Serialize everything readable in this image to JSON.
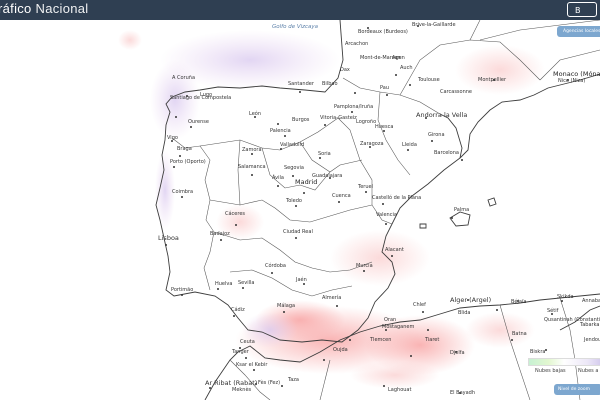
{
  "app": {
    "brand_prefix": "ráfico",
    "brand_suffix": "Nacional",
    "top_button": "B"
  },
  "controls": {
    "agencies_button": "Agencias locales",
    "zoom_button": "Nivel de zoom"
  },
  "legend": {
    "low_clouds": "Nubes bajas",
    "high_clouds": "Nubes a"
  },
  "map_labels": [
    {
      "id": "golfo",
      "text": "Golfo de Vizcaya",
      "kind": "sea"
    },
    {
      "id": "bordeaux",
      "text": "Bordeaux (Burdeos)",
      "kind": "city"
    },
    {
      "id": "brive",
      "text": "Brive-la-Gaillarde",
      "kind": "city"
    },
    {
      "id": "arcachon",
      "text": "Arcachon",
      "kind": "city"
    },
    {
      "id": "agen",
      "text": "Agen",
      "kind": "city"
    },
    {
      "id": "auch",
      "text": "Auch",
      "kind": "city"
    },
    {
      "id": "toulouse",
      "text": "Toulouse",
      "kind": "city"
    },
    {
      "id": "montpellier",
      "text": "Montpellier",
      "kind": "city"
    },
    {
      "id": "monaco",
      "text": "Monaco (Mónaco)",
      "kind": "cap"
    },
    {
      "id": "nice",
      "text": "Nice (Niza)",
      "kind": "city"
    },
    {
      "id": "mdm",
      "text": "Mont-de-Marsan",
      "kind": "city"
    },
    {
      "id": "dax",
      "text": "Dax",
      "kind": "city"
    },
    {
      "id": "pau",
      "text": "Pau",
      "kind": "city"
    },
    {
      "id": "carcassonne",
      "text": "Carcassonne",
      "kind": "city"
    },
    {
      "id": "andorra",
      "text": "Andorra la Vella",
      "kind": "big"
    },
    {
      "id": "santander",
      "text": "Santander",
      "kind": "city"
    },
    {
      "id": "bilbao",
      "text": "Bilbao",
      "kind": "city"
    },
    {
      "id": "vitoria",
      "text": "Vitoria-Gasteiz",
      "kind": "city"
    },
    {
      "id": "pamplona",
      "text": "Pamplona/Iruña",
      "kind": "city"
    },
    {
      "id": "coruna",
      "text": "A Coruña",
      "kind": "city"
    },
    {
      "id": "santiago",
      "text": "Santiago de Compostela",
      "kind": "city"
    },
    {
      "id": "lugo",
      "text": "Lugo",
      "kind": "city"
    },
    {
      "id": "ourense",
      "text": "Ourense",
      "kind": "city"
    },
    {
      "id": "vigo",
      "text": "Vigo",
      "kind": "city"
    },
    {
      "id": "leon",
      "text": "León",
      "kind": "city"
    },
    {
      "id": "burgos",
      "text": "Burgos",
      "kind": "city"
    },
    {
      "id": "logrono",
      "text": "Logroño",
      "kind": "city"
    },
    {
      "id": "huesca",
      "text": "Huesca",
      "kind": "city"
    },
    {
      "id": "girona",
      "text": "Girona",
      "kind": "city"
    },
    {
      "id": "palencia",
      "text": "Palencia",
      "kind": "city"
    },
    {
      "id": "valladolid",
      "text": "Valladolid",
      "kind": "city"
    },
    {
      "id": "zamora",
      "text": "Zamora",
      "kind": "city"
    },
    {
      "id": "soria",
      "text": "Soria",
      "kind": "city"
    },
    {
      "id": "zaragoza",
      "text": "Zaragoza",
      "kind": "city"
    },
    {
      "id": "lleida",
      "text": "Lleida",
      "kind": "city"
    },
    {
      "id": "barcelona",
      "text": "Barcelona",
      "kind": "city"
    },
    {
      "id": "braga",
      "text": "Braga",
      "kind": "city"
    },
    {
      "id": "porto",
      "text": "Porto (Oporto)",
      "kind": "city"
    },
    {
      "id": "salamanca",
      "text": "Salamanca",
      "kind": "city"
    },
    {
      "id": "segovia",
      "text": "Segovia",
      "kind": "city"
    },
    {
      "id": "guadalajara",
      "text": "Guadalajara",
      "kind": "city"
    },
    {
      "id": "madrid",
      "text": "Madrid",
      "kind": "cap"
    },
    {
      "id": "avila",
      "text": "Ávila",
      "kind": "city"
    },
    {
      "id": "teruel",
      "text": "Teruel",
      "kind": "city"
    },
    {
      "id": "toledo",
      "text": "Toledo",
      "kind": "city"
    },
    {
      "id": "cuenca",
      "text": "Cuenca",
      "kind": "city"
    },
    {
      "id": "castellon",
      "text": "Castelló de la Plana",
      "kind": "city"
    },
    {
      "id": "coimbra",
      "text": "Coimbra",
      "kind": "city"
    },
    {
      "id": "caceres",
      "text": "Cáceres",
      "kind": "city"
    },
    {
      "id": "valencia",
      "text": "Valencia",
      "kind": "city"
    },
    {
      "id": "palma",
      "text": "Palma",
      "kind": "city"
    },
    {
      "id": "badajoz",
      "text": "Badajoz",
      "kind": "city"
    },
    {
      "id": "ciudadreal",
      "text": "Ciudad Real",
      "kind": "city"
    },
    {
      "id": "lisboa",
      "text": "Lisboa",
      "kind": "big"
    },
    {
      "id": "cordoba",
      "text": "Córdoba",
      "kind": "city"
    },
    {
      "id": "jaen",
      "text": "Jaén",
      "kind": "city"
    },
    {
      "id": "murcia",
      "text": "Murcia",
      "kind": "city"
    },
    {
      "id": "alicante",
      "text": "Alacant",
      "kind": "city"
    },
    {
      "id": "portimao",
      "text": "Portimão",
      "kind": "city"
    },
    {
      "id": "huelva",
      "text": "Huelva",
      "kind": "city"
    },
    {
      "id": "sevilla",
      "text": "Sevilla",
      "kind": "city"
    },
    {
      "id": "malaga",
      "text": "Málaga",
      "kind": "city"
    },
    {
      "id": "almeria",
      "text": "Almería",
      "kind": "city"
    },
    {
      "id": "cadiz",
      "text": "Cádiz",
      "kind": "city"
    },
    {
      "id": "ceuta",
      "text": "Ceuta",
      "kind": "city"
    },
    {
      "id": "tanger",
      "text": "Tanger",
      "kind": "city"
    },
    {
      "id": "ksar",
      "text": "Ksar el Kebir",
      "kind": "city"
    },
    {
      "id": "alger",
      "text": "Alger (Argel)",
      "kind": "big"
    },
    {
      "id": "skikda",
      "text": "Skikda",
      "kind": "city"
    },
    {
      "id": "annaba",
      "text": "Annaba",
      "kind": "city"
    },
    {
      "id": "bejaia",
      "text": "Béjaïa",
      "kind": "city"
    },
    {
      "id": "setif",
      "text": "Sétif",
      "kind": "city"
    },
    {
      "id": "constantine",
      "text": "Qusantinah (Constantina)",
      "kind": "city"
    },
    {
      "id": "chlef",
      "text": "Chlef",
      "kind": "city"
    },
    {
      "id": "blida",
      "text": "Blida",
      "kind": "city"
    },
    {
      "id": "batna",
      "text": "Batna",
      "kind": "city"
    },
    {
      "id": "mostaganem",
      "text": "Mostaganem",
      "kind": "city"
    },
    {
      "id": "oran",
      "text": "Oran",
      "kind": "city"
    },
    {
      "id": "tlemcen",
      "text": "Tlemcen",
      "kind": "city"
    },
    {
      "id": "tiaret",
      "text": "Tiaret",
      "kind": "city"
    },
    {
      "id": "djelfa",
      "text": "Djelfa",
      "kind": "city"
    },
    {
      "id": "biskra",
      "text": "Biskra",
      "kind": "city"
    },
    {
      "id": "oujda",
      "text": "Oujda",
      "kind": "city"
    },
    {
      "id": "rabat",
      "text": "Ar Ribat (Rabat)",
      "kind": "big"
    },
    {
      "id": "fes",
      "text": "Fès (Fez)",
      "kind": "city"
    },
    {
      "id": "taza",
      "text": "Taza",
      "kind": "city"
    },
    {
      "id": "meknes",
      "text": "Meknès",
      "kind": "city"
    },
    {
      "id": "laghouat",
      "text": "Laghouat",
      "kind": "city"
    },
    {
      "id": "elbayadh",
      "text": "El Bayadh",
      "kind": "city"
    },
    {
      "id": "tabarka",
      "text": "Tabarka",
      "kind": "city"
    },
    {
      "id": "jendouba",
      "text": "Jendouba",
      "kind": "city"
    }
  ]
}
